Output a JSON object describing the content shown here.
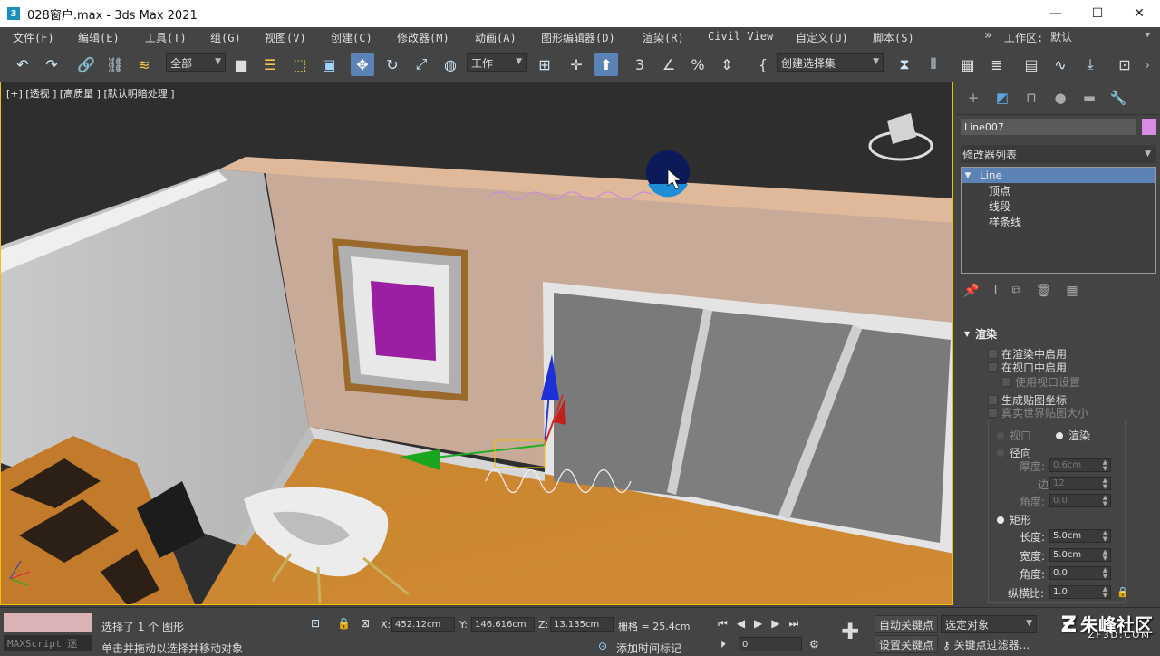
{
  "app": {
    "icon": "3",
    "title": "028窗户.max - 3ds Max 2021"
  },
  "window_controls": {
    "minimize": "—",
    "maximize": "☐",
    "close": "✕"
  },
  "menu": [
    "文件(F)",
    "编辑(E)",
    "工具(T)",
    "组(G)",
    "视图(V)",
    "创建(C)",
    "修改器(M)",
    "动画(A)",
    "图形编辑器(D)",
    "渲染(R)",
    "Civil View",
    "自定义(U)",
    "脚本(S)"
  ],
  "workspace": {
    "chevron": "»",
    "label": "工作区:",
    "value": "默认"
  },
  "toolbar": {
    "selection_filter": "全部",
    "ref_coord": "工作",
    "named_selection": "创建选择集"
  },
  "viewport": {
    "label": "[+] [透视 ] [高质量 ] [默认明暗处理 ]"
  },
  "command_panel": {
    "object_name": "Line007",
    "object_color": "#d98be6",
    "modifier_list": "修改器列表",
    "stack": [
      {
        "label": "Line",
        "selected": true,
        "expand": "▼"
      },
      {
        "label": "顶点",
        "selected": false
      },
      {
        "label": "线段",
        "selected": false
      },
      {
        "label": "样条线",
        "selected": false
      }
    ],
    "rollout_title": "渲染",
    "rollout_expand": "▼",
    "options": {
      "enable_render": "在渲染中启用",
      "enable_viewport": "在视口中启用",
      "use_viewport_settings": "使用视口设置",
      "gen_mapping": "生成贴图坐标",
      "real_world": "真实世界贴图大小",
      "viewport_radio": "视口",
      "render_radio": "渲染",
      "radial": "径向",
      "thickness_label": "厚度:",
      "thickness_value": "0.6cm",
      "sides_label": "边",
      "sides_value": "12",
      "angle_label": "角度:",
      "angle_value": "0.0",
      "rect": "矩形",
      "length_label": "长度:",
      "length_value": "5.0cm",
      "width_label": "宽度:",
      "width_value": "5.0cm",
      "angle2_label": "角度:",
      "angle2_value": "0.0",
      "aspect_label": "纵横比:",
      "aspect_value": "1.0"
    }
  },
  "status": {
    "maxscript": "MAXScript 迷",
    "selected": "选择了 1 个 图形",
    "prompt": "单击并拖动以选择并移动对象",
    "x_label": "X:",
    "x": "452.12cm",
    "y_label": "Y:",
    "y": "146.616cm",
    "z_label": "Z:",
    "z": "13.135cm",
    "grid": "栅格 = 25.4cm",
    "add_time_tag": "添加时间标记",
    "frame": "0",
    "auto_key": "自动关键点",
    "set_key": "设置关键点",
    "selected_object": "选定对象",
    "key_filters": "关键点过滤器..."
  },
  "watermark": {
    "main": "朱峰社区",
    "sub": "ZF3D.COM"
  }
}
